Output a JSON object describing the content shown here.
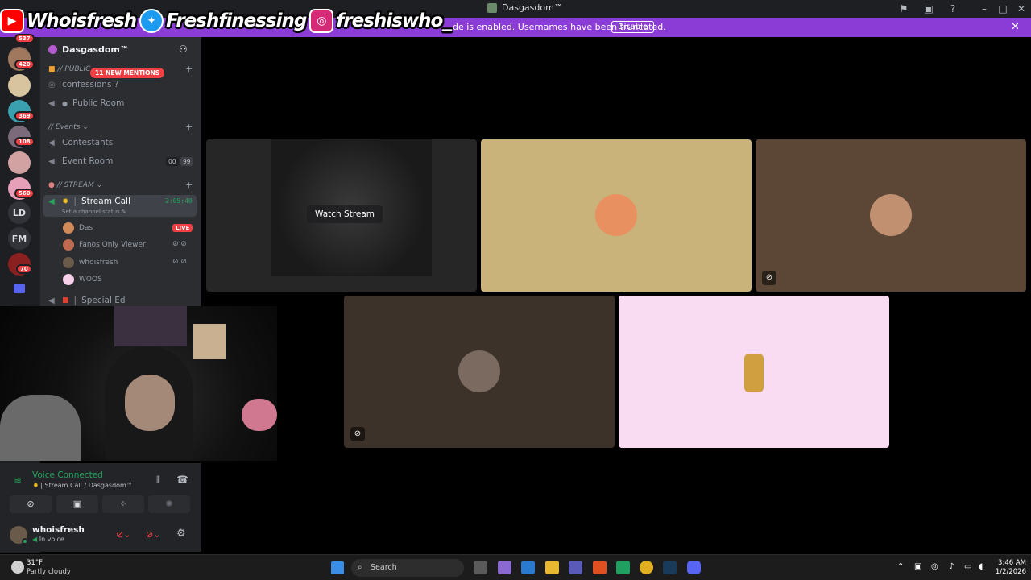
{
  "window": {
    "title": "Dasgasdom™"
  },
  "notice": {
    "text": "de is enabled. Usernames have been truncated.",
    "button": "Disable"
  },
  "social": [
    {
      "platform": "youtube-icon",
      "handle": "Whoisfresh",
      "color": "#ff0000"
    },
    {
      "platform": "twitter-icon",
      "handle": "Freshfinessing",
      "color": "#1d9bf0"
    },
    {
      "platform": "instagram-icon",
      "handle": "freshiswho_",
      "color": "#d62976"
    }
  ],
  "rail": {
    "badges": [
      "537",
      "420",
      "369",
      "108",
      "560",
      "70"
    ],
    "text_servers": [
      "LD",
      "FM"
    ]
  },
  "guild": {
    "name": "Dasgasdom™",
    "mentions": "11 NEW MENTIONS"
  },
  "categories": {
    "public": "// PUBLIC",
    "events": "// Events",
    "stream": "// STREAM"
  },
  "channels": {
    "confessions": "confessions ?",
    "public_room": "Public Room",
    "contestants": "Contestants",
    "event_room": "Event Room",
    "event_room_count_a": "00",
    "event_room_count_b": "99",
    "stream_call": "Stream Call",
    "stream_timer": "2:05:40",
    "stream_status": "Set a channel status",
    "special_ed": "Special Ed"
  },
  "voice_users": [
    {
      "name": "Das",
      "live": "LIVE"
    },
    {
      "name": "Fanos Only Viewer"
    },
    {
      "name": "whoisfresh"
    },
    {
      "name": "WOOS"
    }
  ],
  "voice": {
    "status": "Voice Connected",
    "location": "Stream Call / Dasgasdom™"
  },
  "user": {
    "name": "whoisfresh",
    "status": "In voice"
  },
  "stream": {
    "watch_label": "Watch Stream"
  },
  "tile_colors": [
    "#262626",
    "#c9b37a",
    "#5c4736",
    "#3d3229",
    "#f9dcf1"
  ],
  "taskbar": {
    "temp": "31°F",
    "weather": "Partly cloudy",
    "search_placeholder": "Search",
    "time": "3:46 AM",
    "date": "1/2/2026"
  }
}
